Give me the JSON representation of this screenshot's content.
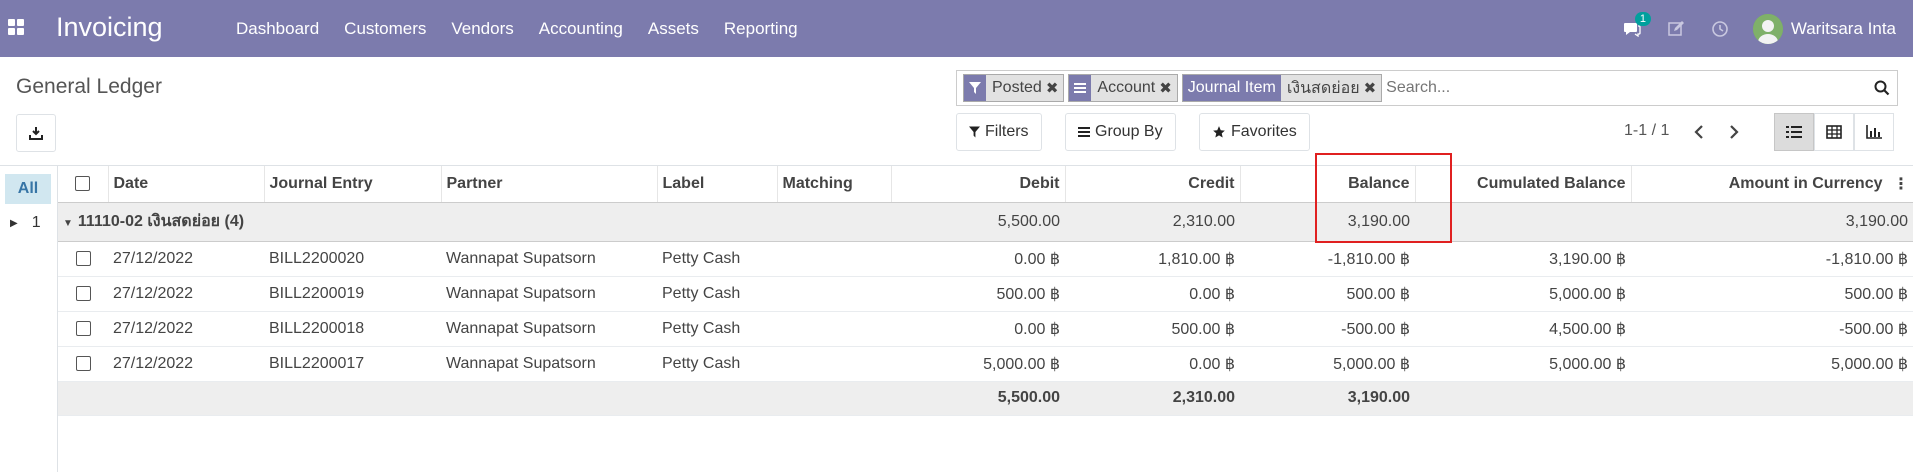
{
  "navbar": {
    "app_name": "Invoicing",
    "menu": [
      "Dashboard",
      "Customers",
      "Vendors",
      "Accounting",
      "Assets",
      "Reporting"
    ],
    "message_count": "1",
    "user_name": "Waritsara Inta",
    "color": "#7c7bad"
  },
  "page": {
    "title": "General Ledger"
  },
  "search": {
    "facets": [
      {
        "icon": "filter-icon",
        "value": "Posted"
      },
      {
        "icon": "group-by-icon",
        "value": "Account"
      },
      {
        "label": "Journal Item",
        "value": "เงินสดย่อย"
      }
    ],
    "placeholder": "Search..."
  },
  "buttons": {
    "filters": "Filters",
    "group_by": "Group By",
    "favorites": "Favorites"
  },
  "pager": {
    "value": "1-1 / 1"
  },
  "side_panel": {
    "all": "All",
    "item": "1"
  },
  "table": {
    "columns": [
      "Date",
      "Journal Entry",
      "Partner",
      "Label",
      "Matching",
      "Debit",
      "Credit",
      "Balance",
      "Cumulated Balance",
      "Amount in Currency"
    ],
    "group": {
      "name": "11110-02 เงินสดย่อย (4)",
      "debit": "5,500.00",
      "credit": "2,310.00",
      "balance": "3,190.00",
      "amount_currency": "3,190.00"
    },
    "rows": [
      {
        "date": "27/12/2022",
        "entry": "BILL2200020",
        "partner": "Wannapat Supatsorn",
        "label": "Petty Cash",
        "matching": "",
        "debit": "0.00 ฿",
        "credit": "1,810.00 ฿",
        "balance": "-1,810.00 ฿",
        "cumulated": "3,190.00 ฿",
        "amount_currency": "-1,810.00 ฿"
      },
      {
        "date": "27/12/2022",
        "entry": "BILL2200019",
        "partner": "Wannapat Supatsorn",
        "label": "Petty Cash",
        "matching": "",
        "debit": "500.00 ฿",
        "credit": "0.00 ฿",
        "balance": "500.00 ฿",
        "cumulated": "5,000.00 ฿",
        "amount_currency": "500.00 ฿"
      },
      {
        "date": "27/12/2022",
        "entry": "BILL2200018",
        "partner": "Wannapat Supatsorn",
        "label": "Petty Cash",
        "matching": "",
        "debit": "0.00 ฿",
        "credit": "500.00 ฿",
        "balance": "-500.00 ฿",
        "cumulated": "4,500.00 ฿",
        "amount_currency": "-500.00 ฿"
      },
      {
        "date": "27/12/2022",
        "entry": "BILL2200017",
        "partner": "Wannapat Supatsorn",
        "label": "Petty Cash",
        "matching": "",
        "debit": "5,000.00 ฿",
        "credit": "0.00 ฿",
        "balance": "5,000.00 ฿",
        "cumulated": "5,000.00 ฿",
        "amount_currency": "5,000.00 ฿"
      }
    ],
    "totals": {
      "debit": "5,500.00",
      "credit": "2,310.00",
      "balance": "3,190.00"
    }
  }
}
